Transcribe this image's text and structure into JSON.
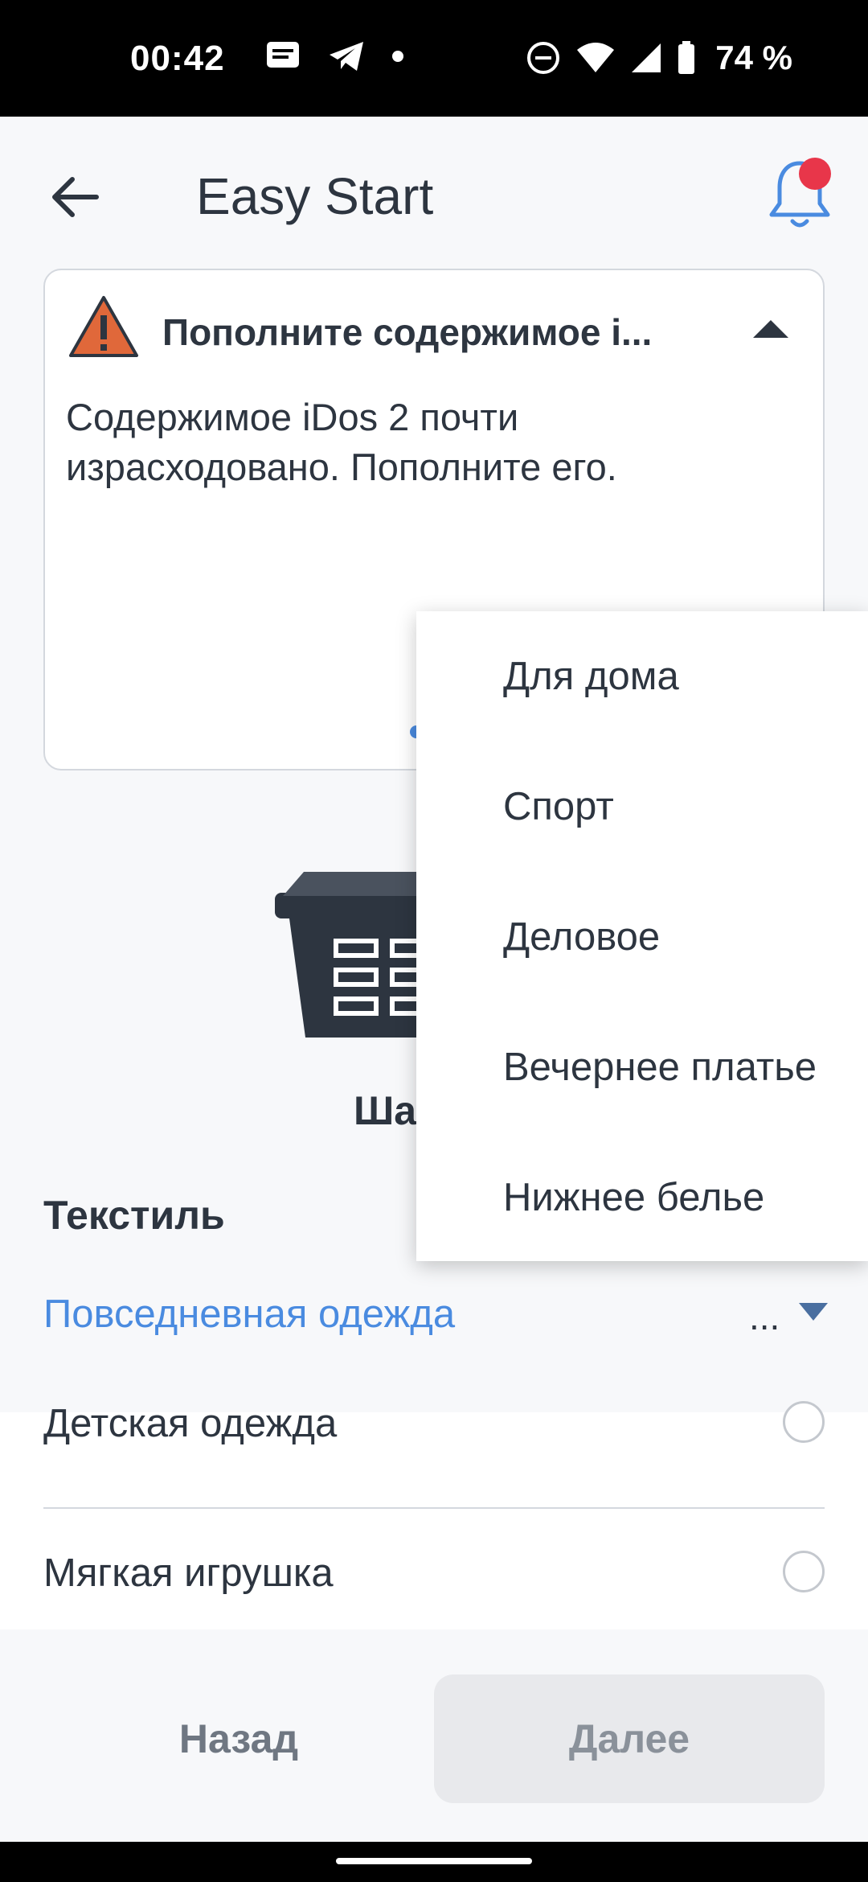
{
  "status_bar": {
    "time": "00:42",
    "battery": "74 %",
    "icons": [
      "messages-icon",
      "telegram-icon",
      "notification-dot-icon",
      "do-not-disturb-icon",
      "wifi-icon",
      "signal-icon",
      "battery-icon"
    ]
  },
  "app_bar": {
    "title": "Easy Start",
    "back_icon": "arrow-left-icon",
    "bell_icon": "bell-icon",
    "badge_color": "#e8364a"
  },
  "alert_card": {
    "heading": "Пополните содержимое i...",
    "body": "Содержимое iDos 2 почти израсходовано. Пополните его.",
    "warning_color": "#e0683a"
  },
  "step": {
    "label": "Ша"
  },
  "section": {
    "title": "Текстиль",
    "selected_value": "Повседневная одежда",
    "ellipsis": "...",
    "accent_color": "#4a8be0"
  },
  "list": {
    "items": [
      {
        "label": "Детская одежда"
      },
      {
        "label": "Мягкая игрушка"
      }
    ]
  },
  "buttons": {
    "back": "Назад",
    "next": "Далее"
  },
  "dropdown": {
    "items": [
      {
        "label": "Для дома"
      },
      {
        "label": "Спорт"
      },
      {
        "label": "Деловое"
      },
      {
        "label": "Вечернее платье"
      },
      {
        "label": "Нижнее белье"
      }
    ]
  }
}
